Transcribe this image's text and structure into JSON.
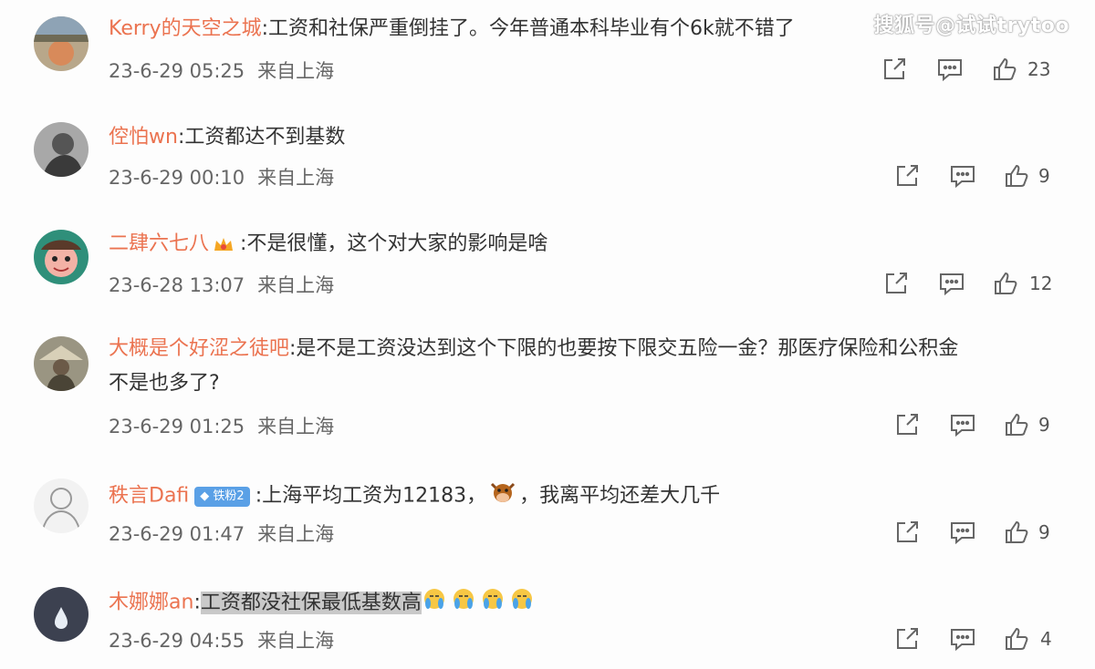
{
  "watermark": "搜狐号@试试trytoo",
  "comments": [
    {
      "username": "Kerry的天空之城",
      "text": ":工资和社保严重倒挂了。今年普通本科毕业有个6k就不错了",
      "time": "23-6-29 05:25",
      "location": "来自上海",
      "likes": "23"
    },
    {
      "username": "倥怕wn",
      "text": ":工资都达不到基数",
      "time": "23-6-29 00:10",
      "location": "来自上海",
      "likes": "9"
    },
    {
      "username": "二肆六七八",
      "text": ":不是很懂，这个对大家的影响是啥",
      "time": "23-6-28 13:07",
      "location": "来自上海",
      "likes": "12"
    },
    {
      "username": "大概是个好涩之徒吧",
      "text": ":是不是工资没达到这个下限的也要按下限交五险一金？那医疗保险和公积金",
      "text_cont": "不是也多了?",
      "time": "23-6-29 01:25",
      "location": "来自上海",
      "likes": "9"
    },
    {
      "username": "秩言Dafi",
      "badge": "铁粉2",
      "text": ":上海平均工资为12183，",
      "text_after": "，我离平均还差大几千",
      "time": "23-6-29 01:47",
      "location": "来自上海",
      "likes": "9"
    },
    {
      "username": "木娜娜an",
      "text": ":",
      "highlight": "工资都没社保最低基数高",
      "time": "23-6-29 04:55",
      "location": "来自上海",
      "likes": "4"
    }
  ]
}
